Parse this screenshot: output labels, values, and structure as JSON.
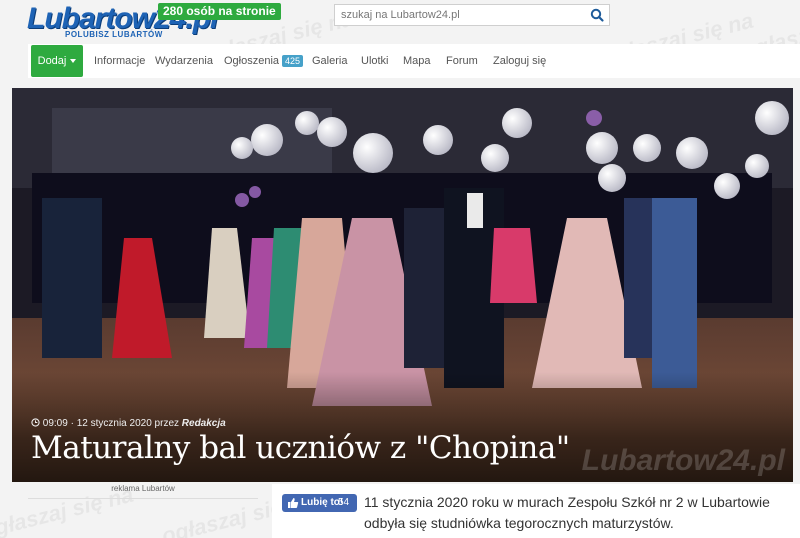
{
  "site": {
    "logo_text": "Lubartow24.pl",
    "logo_tagline": "POLUBISZ LUBARTÓW",
    "online_badge": "280 osób na stronie",
    "watermark_text": "ogłaszaj się na"
  },
  "search": {
    "placeholder": "szukaj na Lubartow24.pl",
    "icon": "search-icon"
  },
  "nav": {
    "add_label": "Dodaj",
    "items": [
      {
        "label": "Informacje"
      },
      {
        "label": "Wydarzenia"
      },
      {
        "label": "Ogłoszenia",
        "badge": "425"
      },
      {
        "label": "Galeria"
      },
      {
        "label": "Ulotki"
      },
      {
        "label": "Mapa"
      },
      {
        "label": "Forum"
      },
      {
        "label": "Zaloguj się"
      }
    ]
  },
  "article": {
    "time": "09:09",
    "date": "12 stycznia 2020",
    "by": "przez",
    "author": "Redakcja",
    "title": "Maturalny bal uczniów z \"Chopina\"",
    "photo_watermark": "Lubartow24.pl",
    "lead": "11 stycznia 2020 roku w murach Zespołu Szkół nr 2 w Lubartowie odbyła się studniówka tegorocznych maturzystów."
  },
  "sidebar": {
    "ad_label": "reklama Lubartów"
  },
  "like": {
    "label": "Lubię to!",
    "count": "54"
  },
  "colors": {
    "brand_blue": "#1e63b5",
    "green": "#2eaa3f",
    "badge_blue": "#46a1c9",
    "fb_blue": "#4267b2"
  }
}
